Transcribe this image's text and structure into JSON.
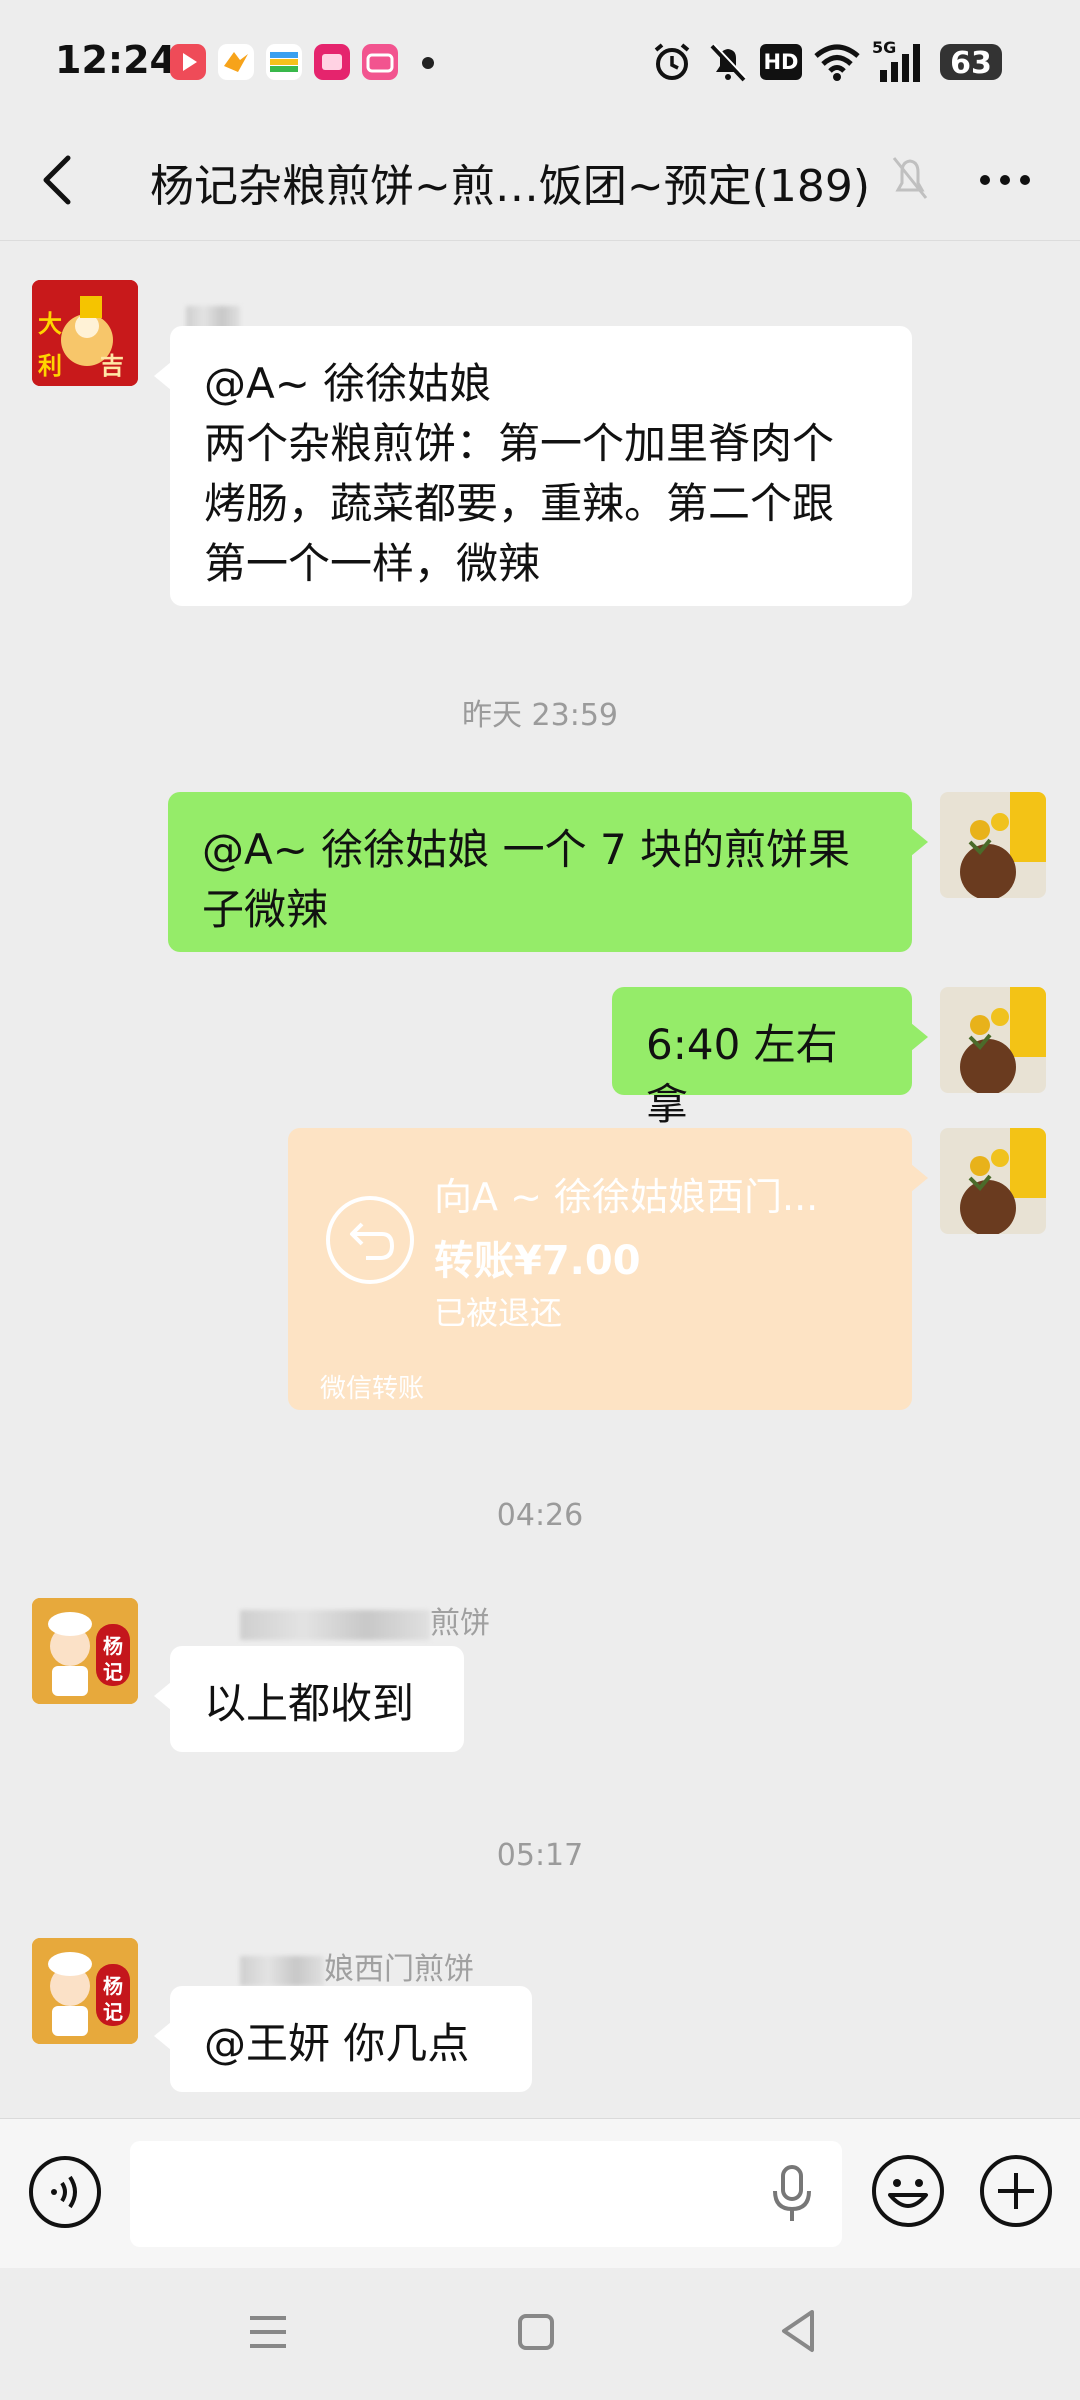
{
  "status_bar": {
    "time": "12:24",
    "network": "5G",
    "hd": "HD",
    "battery": "63",
    "icons": [
      "video-app-icon",
      "cloud-app-icon",
      "wallet-app-icon",
      "promo-app-icon",
      "bilibili-app-icon",
      "alarm-icon",
      "mute-bell-icon",
      "wifi-icon",
      "signal-icon"
    ]
  },
  "header": {
    "title": "杨记杂粮煎饼~煎…饭团~预定(189)",
    "icons": [
      "back-arrow-icon",
      "muted-bell-icon",
      "more-dots-icon"
    ]
  },
  "messages": {
    "m1": {
      "side": "left",
      "mention": "@A~ 徐徐姑娘",
      "lines": [
        "两个杂粮煎饼：第一个加里脊肉个",
        "烤肠，蔬菜都要，重辣。第二个跟",
        "第一个一样，微辣"
      ]
    },
    "ts1": "昨天 23:59",
    "m2": {
      "side": "right",
      "lines": [
        "@A~ 徐徐姑娘  一个 7 块的煎饼果",
        "子微辣"
      ]
    },
    "m3": {
      "side": "right",
      "text": "6:40 左右拿"
    },
    "transfer": {
      "to": "向A ~ 徐徐姑娘西门...",
      "amount": "转账¥7.00",
      "status": "已被退还",
      "footer": "微信转账"
    },
    "ts2": "04:26",
    "m4": {
      "side": "left",
      "sender_visible": "煎饼",
      "text": "以上都收到"
    },
    "ts3": "05:17",
    "m5": {
      "side": "left",
      "sender_visible": "娘西门煎饼",
      "text": "@王妍  你几点"
    }
  },
  "avatars": {
    "left_1_text": [
      "大",
      "利",
      "吉"
    ],
    "shop_badge": [
      "杨",
      "记"
    ]
  },
  "input_bar": {
    "value": "",
    "placeholder": ""
  },
  "colors": {
    "background": "#ededed",
    "bubble_green": "#95ec69",
    "bubble_white": "#ffffff",
    "transfer_refunded": "#fde3c4"
  }
}
